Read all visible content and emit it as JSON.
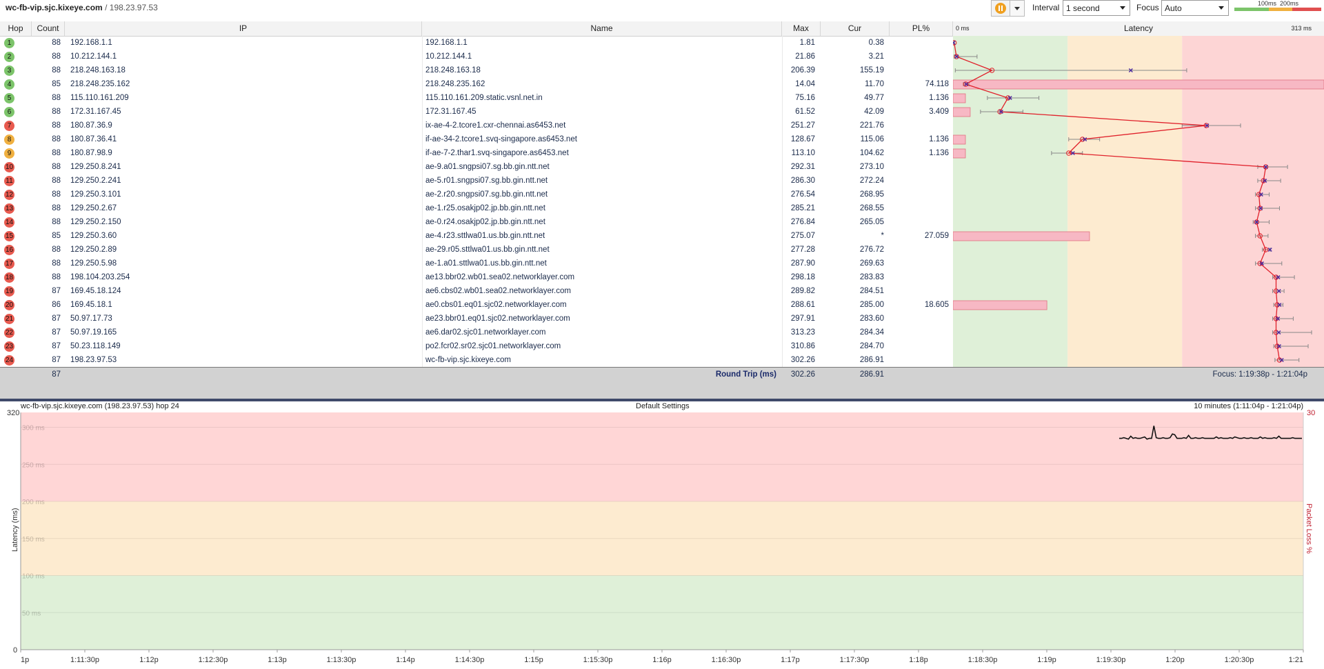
{
  "header": {
    "host": "wc-fb-vip.sjc.kixeye.com",
    "separator": "/",
    "ip": "198.23.97.53",
    "interval_label": "Interval",
    "interval_value": "1 second",
    "focus_label": "Focus",
    "focus_value": "Auto",
    "scale_low": "100ms",
    "scale_high": "200ms"
  },
  "colors": {
    "good": "#dff0d8",
    "warn": "#fdebd0",
    "bad": "#fdd5d5",
    "pl_bar": "#f7b8c4",
    "line": "#e0202a",
    "marker": "#4a2aa0"
  },
  "columns": {
    "hop": "Hop",
    "count": "Count",
    "ip": "IP",
    "name": "Name",
    "max": "Max",
    "cur": "Cur",
    "pl": "PL%",
    "latency": "Latency",
    "lat_min": "0 ms",
    "lat_max": "313 ms"
  },
  "hops": [
    {
      "hop": "1",
      "count": "88",
      "ip": "192.168.1.1",
      "name": "192.168.1.1",
      "max": "1.81",
      "cur": "0.38",
      "pl": "",
      "avg": 1,
      "mn": 0,
      "mx": 1,
      "plv": 0
    },
    {
      "hop": "2",
      "count": "88",
      "ip": "10.212.144.1",
      "name": "10.212.144.1",
      "max": "21.86",
      "cur": "3.21",
      "pl": "",
      "avg": 3,
      "mn": 1,
      "mx": 21,
      "plv": 0
    },
    {
      "hop": "3",
      "count": "88",
      "ip": "218.248.163.18",
      "name": "218.248.163.18",
      "max": "206.39",
      "cur": "155.19",
      "pl": "",
      "avg": 34,
      "mn": 2,
      "mx": 204,
      "plv": 0
    },
    {
      "hop": "4",
      "count": "85",
      "ip": "218.248.235.162",
      "name": "218.248.235.162",
      "max": "14.04",
      "cur": "11.70",
      "pl": "74.118",
      "avg": 11,
      "mn": 9,
      "mx": 14,
      "plv": 74.118
    },
    {
      "hop": "5",
      "count": "88",
      "ip": "115.110.161.209",
      "name": "115.110.161.209.static.vsnl.net.in",
      "max": "75.16",
      "cur": "49.77",
      "pl": "1.136",
      "avg": 48,
      "mn": 30,
      "mx": 75,
      "plv": 1.136
    },
    {
      "hop": "6",
      "count": "88",
      "ip": "172.31.167.45",
      "name": "172.31.167.45",
      "max": "61.52",
      "cur": "42.09",
      "pl": "3.409",
      "avg": 41,
      "mn": 24,
      "mx": 61,
      "plv": 3.409
    },
    {
      "hop": "7",
      "count": "88",
      "ip": "180.87.36.9",
      "name": "ix-ae-4-2.tcore1.cxr-chennai.as6453.net",
      "max": "251.27",
      "cur": "221.76",
      "pl": "",
      "avg": 221,
      "mn": 200,
      "mx": 251,
      "plv": 0
    },
    {
      "hop": "8",
      "count": "88",
      "ip": "180.87.36.41",
      "name": "if-ae-34-2.tcore1.svq-singapore.as6453.net",
      "max": "128.67",
      "cur": "115.06",
      "pl": "1.136",
      "avg": 113,
      "mn": 101,
      "mx": 128,
      "plv": 1.136
    },
    {
      "hop": "9",
      "count": "88",
      "ip": "180.87.98.9",
      "name": "if-ae-7-2.thar1.svq-singapore.as6453.net",
      "max": "113.10",
      "cur": "104.62",
      "pl": "1.136",
      "avg": 101,
      "mn": 86,
      "mx": 113,
      "plv": 1.136
    },
    {
      "hop": "10",
      "count": "88",
      "ip": "129.250.8.241",
      "name": "ae-9.a01.sngpsi07.sg.bb.gin.ntt.net",
      "max": "292.31",
      "cur": "273.10",
      "pl": "",
      "avg": 273,
      "mn": 266,
      "mx": 292,
      "plv": 0
    },
    {
      "hop": "11",
      "count": "88",
      "ip": "129.250.2.241",
      "name": "ae-5.r01.sngpsi07.sg.bb.gin.ntt.net",
      "max": "286.30",
      "cur": "272.24",
      "pl": "",
      "avg": 271,
      "mn": 266,
      "mx": 286,
      "plv": 0
    },
    {
      "hop": "12",
      "count": "88",
      "ip": "129.250.3.101",
      "name": "ae-2.r20.sngpsi07.sg.bb.gin.ntt.net",
      "max": "276.54",
      "cur": "268.95",
      "pl": "",
      "avg": 267,
      "mn": 264,
      "mx": 276,
      "plv": 0
    },
    {
      "hop": "13",
      "count": "88",
      "ip": "129.250.2.67",
      "name": "ae-1.r25.osakjp02.jp.bb.gin.ntt.net",
      "max": "285.21",
      "cur": "268.55",
      "pl": "",
      "avg": 268,
      "mn": 264,
      "mx": 285,
      "plv": 0
    },
    {
      "hop": "14",
      "count": "88",
      "ip": "129.250.2.150",
      "name": "ae-0.r24.osakjp02.jp.bb.gin.ntt.net",
      "max": "276.84",
      "cur": "265.05",
      "pl": "",
      "avg": 265,
      "mn": 262,
      "mx": 276,
      "plv": 0
    },
    {
      "hop": "15",
      "count": "85",
      "ip": "129.250.3.60",
      "name": "ae-4.r23.sttlwa01.us.bb.gin.ntt.net",
      "max": "275.07",
      "cur": "*",
      "pl": "27.059",
      "avg": 268,
      "mn": 264,
      "mx": 275,
      "plv": 27.059
    },
    {
      "hop": "16",
      "count": "88",
      "ip": "129.250.2.89",
      "name": "ae-29.r05.sttlwa01.us.bb.gin.ntt.net",
      "max": "277.28",
      "cur": "276.72",
      "pl": "",
      "avg": 273,
      "mn": 270,
      "mx": 277,
      "plv": 0
    },
    {
      "hop": "17",
      "count": "88",
      "ip": "129.250.5.98",
      "name": "ae-1.a01.sttlwa01.us.bb.gin.ntt.net",
      "max": "287.90",
      "cur": "269.63",
      "pl": "",
      "avg": 268,
      "mn": 264,
      "mx": 287,
      "plv": 0
    },
    {
      "hop": "18",
      "count": "88",
      "ip": "198.104.203.254",
      "name": "ae13.bbr02.wb01.sea02.networklayer.com",
      "max": "298.18",
      "cur": "283.83",
      "pl": "",
      "avg": 282,
      "mn": 279,
      "mx": 298,
      "plv": 0
    },
    {
      "hop": "19",
      "count": "87",
      "ip": "169.45.18.124",
      "name": "ae6.cbs02.wb01.sea02.networklayer.com",
      "max": "289.82",
      "cur": "284.51",
      "pl": "",
      "avg": 282,
      "mn": 279,
      "mx": 289,
      "plv": 0
    },
    {
      "hop": "20",
      "count": "86",
      "ip": "169.45.18.1",
      "name": "ae0.cbs01.eq01.sjc02.networklayer.com",
      "max": "288.61",
      "cur": "285.00",
      "pl": "18.605",
      "avg": 283,
      "mn": 280,
      "mx": 288,
      "plv": 18.605
    },
    {
      "hop": "21",
      "count": "87",
      "ip": "50.97.17.73",
      "name": "ae23.bbr01.eq01.sjc02.networklayer.com",
      "max": "297.91",
      "cur": "283.60",
      "pl": "",
      "avg": 282,
      "mn": 279,
      "mx": 297,
      "plv": 0
    },
    {
      "hop": "22",
      "count": "87",
      "ip": "50.97.19.165",
      "name": "ae6.dar02.sjc01.networklayer.com",
      "max": "313.23",
      "cur": "284.34",
      "pl": "",
      "avg": 282,
      "mn": 279,
      "mx": 313,
      "plv": 0
    },
    {
      "hop": "23",
      "count": "87",
      "ip": "50.23.118.149",
      "name": "po2.fcr02.sr02.sjc01.networklayer.com",
      "max": "310.86",
      "cur": "284.70",
      "pl": "",
      "avg": 283,
      "mn": 280,
      "mx": 310,
      "plv": 0
    },
    {
      "hop": "24",
      "count": "87",
      "ip": "198.23.97.53",
      "name": "wc-fb-vip.sjc.kixeye.com",
      "max": "302.26",
      "cur": "286.91",
      "pl": "",
      "avg": 285,
      "mn": 281,
      "mx": 302,
      "plv": 0
    }
  ],
  "summary": {
    "count": "87",
    "label": "Round Trip (ms)",
    "max": "302.26",
    "cur": "286.91",
    "focus": "Focus: 1:19:38p - 1:21:04p"
  },
  "graph": {
    "title_left": "wc-fb-vip.sjc.kixeye.com (198.23.97.53) hop 24",
    "title_center": "Default Settings",
    "title_right": "10 minutes (1:11:04p - 1:21:04p)",
    "y_max_label": "320",
    "y_zero_label": "0",
    "pl_max_label": "30",
    "y_axis_label": "Latency (ms)",
    "pl_axis_label": "Packet Loss %",
    "band_labels": [
      "300 ms",
      "250 ms",
      "200 ms",
      "150 ms",
      "100 ms",
      "50 ms"
    ],
    "x_ticks": [
      "1p",
      "1:11:30p",
      "1:12p",
      "1:12:30p",
      "1:13p",
      "1:13:30p",
      "1:14p",
      "1:14:30p",
      "1:15p",
      "1:15:30p",
      "1:16p",
      "1:16:30p",
      "1:17p",
      "1:17:30p",
      "1:18p",
      "1:18:30p",
      "1:19p",
      "1:19:30p",
      "1:20p",
      "1:20:30p",
      "1:21"
    ],
    "trace_ms": [
      285,
      285,
      286,
      285,
      284,
      288,
      285,
      286,
      285,
      285,
      286,
      287,
      284,
      285,
      285,
      302,
      286,
      285,
      285,
      286,
      285,
      285,
      286,
      291,
      290,
      285,
      285,
      285,
      286,
      285,
      289,
      285,
      285,
      286,
      285,
      285,
      286,
      285,
      285,
      285,
      285,
      285,
      287,
      285,
      286,
      285,
      285,
      285,
      286,
      285,
      287,
      286,
      285,
      285,
      286,
      285,
      285,
      286,
      285,
      285,
      285,
      287,
      285,
      286,
      285,
      285,
      285,
      286,
      285,
      288,
      285,
      285,
      285,
      285,
      285,
      286,
      285,
      285,
      285,
      285
    ]
  }
}
